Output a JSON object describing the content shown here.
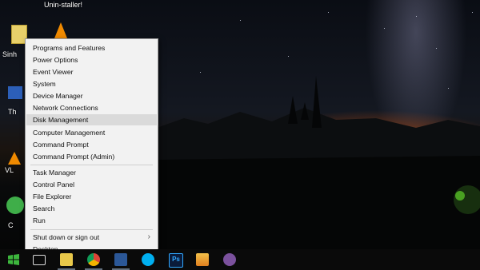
{
  "desktop": {
    "top_label": "Unin-staller!",
    "icon_labels": [
      "Sinh",
      "Th",
      "VL",
      "C"
    ]
  },
  "context_menu": {
    "items": [
      {
        "label": "Programs and Features"
      },
      {
        "label": "Power Options"
      },
      {
        "label": "Event Viewer"
      },
      {
        "label": "System"
      },
      {
        "label": "Device Manager"
      },
      {
        "label": "Network Connections"
      },
      {
        "label": "Disk Management",
        "highlighted": true
      },
      {
        "label": "Computer Management"
      },
      {
        "label": "Command Prompt"
      },
      {
        "label": "Command Prompt (Admin)"
      },
      {
        "label": "Task Manager"
      },
      {
        "label": "Control Panel"
      },
      {
        "label": "File Explorer"
      },
      {
        "label": "Search"
      },
      {
        "label": "Run"
      },
      {
        "label": "Shut down or sign out",
        "submenu": true
      },
      {
        "label": "Desktop"
      }
    ]
  },
  "taskbar": {
    "icons": [
      "start-icon",
      "task-view-icon",
      "file-explorer-icon",
      "chrome-icon",
      "word-icon",
      "skype-icon",
      "photoshop-icon",
      "media-player-icon",
      "viber-icon"
    ],
    "photoshop_label": "Ps",
    "accent": "#1e90ff"
  }
}
